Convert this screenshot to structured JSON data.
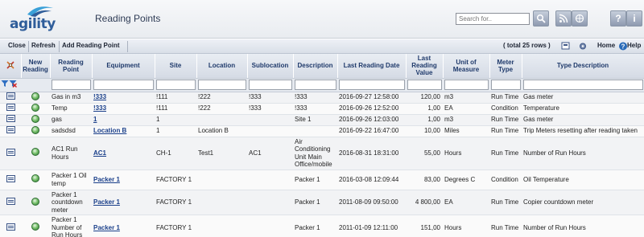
{
  "app": {
    "logo_text": "agility",
    "page_title": "Reading Points"
  },
  "search": {
    "placeholder": "Search for.."
  },
  "header_buttons": {
    "help_label": "?",
    "info_label": "i"
  },
  "toolbar": {
    "close": "Close",
    "refresh": "Refresh",
    "add": "Add Reading Point",
    "total": "( total 25 rows )",
    "home": "Home",
    "help": "Help"
  },
  "columns": [
    "",
    "New Reading",
    "Reading Point",
    "Equipment",
    "Site",
    "Location",
    "Sublocation",
    "Description",
    "Last Reading Date",
    "Last Reading Value",
    "Unit of Measure",
    "Meter Type",
    "Type Description"
  ],
  "rows": [
    {
      "point": "Gas in m3",
      "equipment": "!333",
      "equipment_link": true,
      "site": "!111",
      "location": "!222",
      "sublocation": "!333",
      "description": "!333",
      "date": "2016-09-27 12:58:00",
      "value": "120,00",
      "unit": "m3",
      "meter": "Run Time",
      "type_desc": "Gas meter"
    },
    {
      "point": "Temp",
      "equipment": "!333",
      "equipment_link": true,
      "site": "!111",
      "location": "!222",
      "sublocation": "!333",
      "description": "!333",
      "date": "2016-09-26 12:52:00",
      "value": "1,00",
      "unit": "EA",
      "meter": "Condition",
      "type_desc": "Temperature"
    },
    {
      "point": "gas",
      "equipment": "1",
      "equipment_link": true,
      "site": "1",
      "location": "",
      "sublocation": "",
      "description": "Site 1",
      "date": "2016-09-26 12:03:00",
      "value": "1,00",
      "unit": "m3",
      "meter": "Run Time",
      "type_desc": "Gas meter"
    },
    {
      "point": "sadsdsd",
      "equipment": "Location B",
      "equipment_link": true,
      "site": "1",
      "location": "Location B",
      "sublocation": "",
      "description": "",
      "date": "2016-09-22 16:47:00",
      "value": "10,00",
      "unit": "Miles",
      "meter": "Run Time",
      "type_desc": "Trip Meters resetting after reading taken"
    },
    {
      "point": "AC1 Run Hours",
      "equipment": "AC1",
      "equipment_link": true,
      "site": "CH-1",
      "location": "Test1",
      "sublocation": "AC1",
      "description": "Air Conditioning Unit Main Office/mobile",
      "date": "2016-08-31 18:31:00",
      "value": "55,00",
      "unit": "Hours",
      "meter": "Run Time",
      "type_desc": "Number of Run Hours"
    },
    {
      "point": "Packer 1 Oil temp",
      "equipment": "Packer 1",
      "equipment_link": true,
      "site": "FACTORY 1",
      "location": "",
      "sublocation": "",
      "description": "Packer 1",
      "date": "2016-03-08 12:09:44",
      "value": "83,00",
      "unit": "Degrees C",
      "meter": "Condition",
      "type_desc": "Oil Temperature"
    },
    {
      "point": "Packer 1 countdown meter",
      "equipment": "Packer 1",
      "equipment_link": true,
      "site": "FACTORY 1",
      "location": "",
      "sublocation": "",
      "description": "Packer 1",
      "date": "2011-08-09 09:50:00",
      "value": "4 800,00",
      "unit": "EA",
      "meter": "Run Time",
      "type_desc": "Copier countdown meter"
    },
    {
      "point": "Packer 1 Number of Run Hours",
      "equipment": "Packer 1",
      "equipment_link": true,
      "site": "FACTORY 1",
      "location": "",
      "sublocation": "",
      "description": "Packer 1",
      "date": "2011-01-09 12:11:00",
      "value": "151,00",
      "unit": "Hours",
      "meter": "Run Time",
      "type_desc": "Number of Run Hours"
    }
  ],
  "icons": {
    "row_view": "view-record-icon",
    "new_reading": "new-reading-icon",
    "filter": "filter-icon",
    "clear_filter": "clear-filter-icon",
    "column_config": "column-config-icon"
  },
  "colors": {
    "brand": "#2f5d9a",
    "header_text": "#1f3a6b",
    "link": "#1a3f8a"
  }
}
